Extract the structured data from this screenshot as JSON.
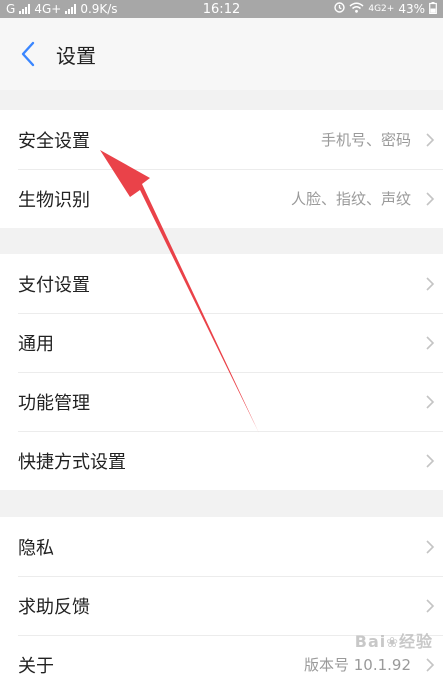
{
  "status_bar": {
    "carrier_g": "G",
    "network": "4G+",
    "speed": "0.9K/s",
    "time": "16:12",
    "network_right": "4G2+",
    "battery": "43%"
  },
  "header": {
    "title": "设置"
  },
  "groups": [
    [
      {
        "label": "安全设置",
        "value": "手机号、密码"
      },
      {
        "label": "生物识别",
        "value": "人脸、指纹、声纹"
      }
    ],
    [
      {
        "label": "支付设置",
        "value": ""
      },
      {
        "label": "通用",
        "value": ""
      },
      {
        "label": "功能管理",
        "value": ""
      },
      {
        "label": "快捷方式设置",
        "value": ""
      }
    ],
    [
      {
        "label": "隐私",
        "value": ""
      },
      {
        "label": "求助反馈",
        "value": ""
      },
      {
        "label": "关于",
        "value": "版本号 10.1.92"
      }
    ]
  ],
  "icons": {
    "back": "chevron-left-icon",
    "row_arrow": "chevron-right-icon"
  },
  "colors": {
    "accent": "#3a86ff",
    "annotation": "#e8323a"
  }
}
